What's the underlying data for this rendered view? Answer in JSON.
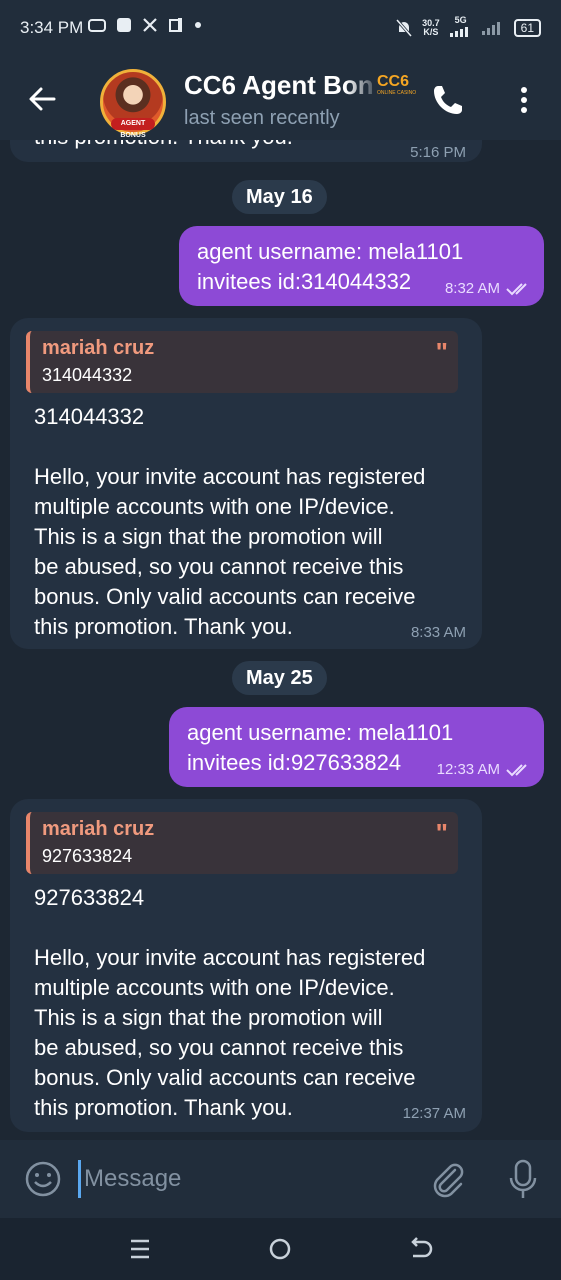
{
  "status_bar": {
    "time": "3:34 PM",
    "net_speed": "30.7",
    "net_unit": "K/S",
    "network": "5G",
    "battery": "61"
  },
  "header": {
    "title": "CC6 Agent Bon",
    "subtitle": "last seen recently",
    "logo_text": "CC6",
    "logo_sub": "ONLINE CASINO",
    "avatar_badge": "AGENT BONUS"
  },
  "messages": {
    "top_partial": {
      "text": "this promotion. Thank you.",
      "time": "5:16 PM"
    },
    "date1": "May 16",
    "out1": {
      "line1": "agent username: mela1101",
      "line2": "invitees id:314044332",
      "time": "8:32 AM"
    },
    "in1": {
      "reply_name": "mariah cruz",
      "reply_text": "314044332",
      "text": "314044332\n\nHello, your invite account has registered\nmultiple accounts with one IP/device.\nThis is a sign that the promotion will\nbe abused, so you cannot receive this\nbonus. Only valid accounts can receive\nthis promotion. Thank you.",
      "time": "8:33 AM"
    },
    "date2": "May 25",
    "out2": {
      "line1": "agent username: mela1101",
      "line2": "invitees id:927633824",
      "time": "12:33 AM"
    },
    "in2": {
      "reply_name": "mariah cruz",
      "reply_text": "927633824",
      "text": "927633824\n\nHello, your invite account has registered\nmultiple accounts with one IP/device.\nThis is a sign that the promotion will\nbe abused, so you cannot receive this\nbonus. Only valid accounts can receive\nthis promotion. Thank you.",
      "time": "12:37 AM"
    }
  },
  "composer": {
    "placeholder": "Message"
  },
  "colors": {
    "outgoing_bubble": "#8d4ad6",
    "incoming_bubble": "#243141",
    "reply_accent": "#e8866b",
    "background": "#1d2733"
  }
}
